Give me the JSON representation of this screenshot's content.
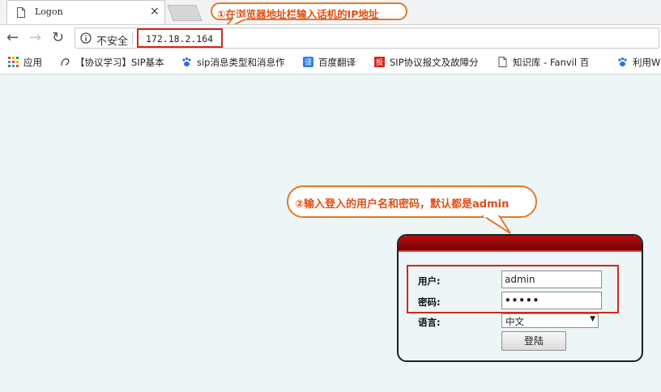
{
  "tab": {
    "title": "Logon",
    "close": "×"
  },
  "toolbar": {
    "back": "←",
    "forward": "→",
    "reload": "↻",
    "security_label": "不安全",
    "url": "172.18.2.164"
  },
  "bookmarks": [
    {
      "icon": "apps-grid-icon",
      "label": "应用"
    },
    {
      "icon": "site-logo-icon",
      "label": "【协议学习】SIP基本"
    },
    {
      "icon": "baidu-paw-icon",
      "label": "sip消息类型和消息作"
    },
    {
      "icon": "translate-icon",
      "label": "百度翻译"
    },
    {
      "icon": "red-badge-icon",
      "label": "SIP协议报文及故障分"
    },
    {
      "icon": "document-icon",
      "label": "知识库 - Fanvil 百"
    },
    {
      "icon": "baidu-paw-icon",
      "label": "利用W"
    }
  ],
  "annotations": {
    "step1": "①在浏览器地址栏输入话机的IP地址",
    "step2": "②输入登入的用户名和密码，默认都是admin"
  },
  "login": {
    "user_label": "用户:",
    "user_value": "admin",
    "password_label": "密码:",
    "password_value": "•••••",
    "language_label": "语言:",
    "language_value": "中文",
    "submit_label": "登陆"
  },
  "colors": {
    "annotation_border": "#e07a2a",
    "annotation_text": "#e44d14",
    "highlight": "#d0281c",
    "panel_header": "#9a0a0a"
  }
}
